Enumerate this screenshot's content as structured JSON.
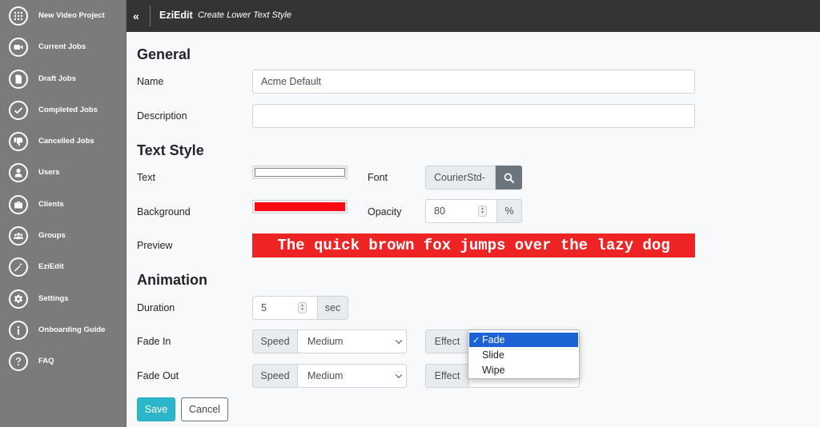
{
  "sidebar": {
    "items": [
      {
        "label": "New Video Project",
        "icon": "grid-icon"
      },
      {
        "label": "Current Jobs",
        "icon": "video-camera-icon"
      },
      {
        "label": "Draft Jobs",
        "icon": "document-icon"
      },
      {
        "label": "Completed Jobs",
        "icon": "check-icon"
      },
      {
        "label": "Cancelled Jobs",
        "icon": "thumbs-down-icon"
      },
      {
        "label": "Users",
        "icon": "user-icon"
      },
      {
        "label": "Clients",
        "icon": "briefcase-icon"
      },
      {
        "label": "Groups",
        "icon": "group-icon"
      },
      {
        "label": "EziEdit",
        "icon": "magic-wand-icon"
      },
      {
        "label": "Settings",
        "icon": "gear-icon"
      },
      {
        "label": "Onboarding Guide",
        "icon": "info-icon"
      },
      {
        "label": "FAQ",
        "icon": "question-icon"
      }
    ]
  },
  "topbar": {
    "collapse": "«",
    "app_title": "EziEdit",
    "page_subtitle": "Create Lower Text Style"
  },
  "general": {
    "title": "General",
    "name_label": "Name",
    "name_value": "Acme Default",
    "description_label": "Description",
    "description_value": ""
  },
  "text_style": {
    "title": "Text Style",
    "text_label": "Text",
    "text_color": "#ffffff",
    "font_label": "Font",
    "font_value": "CourierStd-",
    "background_label": "Background",
    "background_color": "#ff0a14",
    "opacity_label": "Opacity",
    "opacity_value": "80",
    "opacity_unit": "%",
    "preview_label": "Preview",
    "preview_text": "The quick brown fox jumps over the lazy dog"
  },
  "animation": {
    "title": "Animation",
    "duration_label": "Duration",
    "duration_value": "5",
    "duration_unit": "sec",
    "fade_in_label": "Fade In",
    "fade_out_label": "Fade Out",
    "speed_label": "Speed",
    "effect_label": "Effect",
    "fade_in_speed": "Medium",
    "fade_out_speed": "Medium",
    "effect_options": [
      "Fade",
      "Slide",
      "Wipe"
    ],
    "effect_selected": "Fade",
    "check_mark": "✓"
  },
  "buttons": {
    "save": "Save",
    "cancel": "Cancel"
  },
  "colors": {
    "accent": "#2bb6cc",
    "sidebar": "#7b7b7b",
    "topbar": "#343434",
    "preview_bg": "#ee2424",
    "dropdown_highlight": "#1e63d6"
  }
}
